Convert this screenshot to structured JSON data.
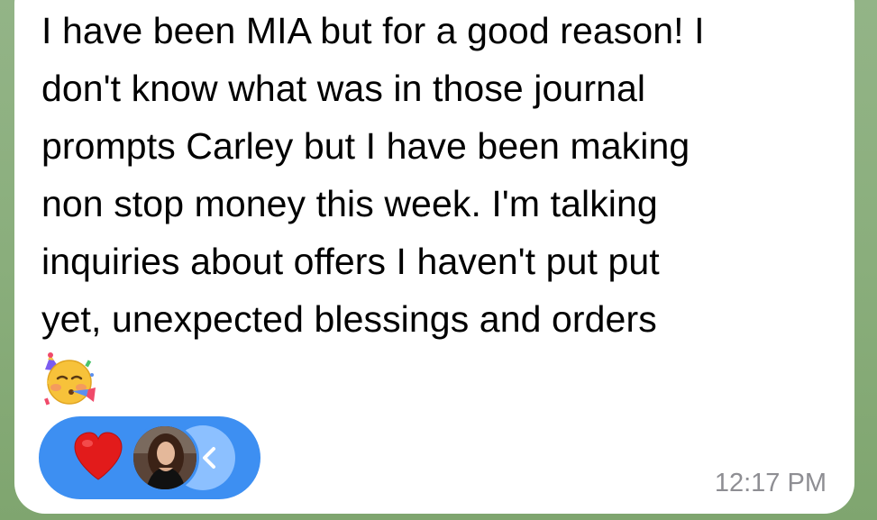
{
  "message": {
    "text": "I have been MIA but for a good reason! I\ndon't know what was in those journal\nprompts Carley but I have been making\nnon stop money this week. I'm talking\ninquiries about offers I haven't put put\nyet, unexpected blessings and orders",
    "emoji": "partying-face-icon",
    "timestamp": "12:17 PM"
  },
  "reactions": {
    "reaction": "heart-icon",
    "reactor": "avatar"
  },
  "colors": {
    "bubble": "#ffffff",
    "background": "#8aae7c",
    "reaction_pill": "#3d8ff2",
    "heart": "#e21b1b",
    "timestamp": "#8e8e93"
  }
}
